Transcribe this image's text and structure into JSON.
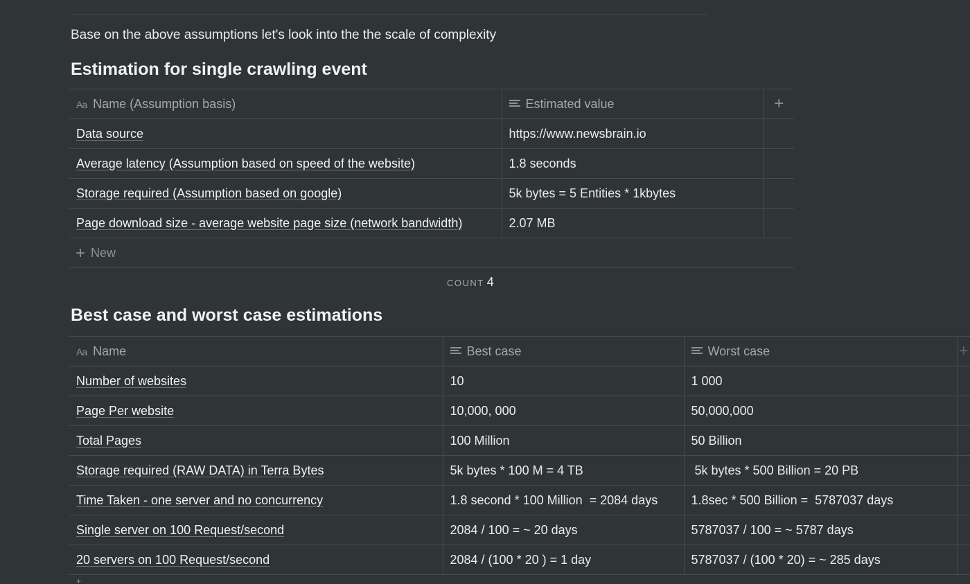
{
  "intro_text": "Base on the above assumptions let's look into the the scale of complexity",
  "section1": {
    "heading": "Estimation for single crawling event",
    "headers": [
      "Name (Assumption basis)",
      "Estimated value"
    ],
    "rows": [
      {
        "name": "Data source",
        "value": "https://www.newsbrain.io"
      },
      {
        "name": "Average latency (Assumption based on speed of the website)",
        "value": "1.8 seconds"
      },
      {
        "name": "Storage required (Assumption based on google)",
        "value": "5k bytes = 5 Entities * 1kbytes"
      },
      {
        "name": "Page download size - average website page size (network bandwidth)",
        "value": "2.07 MB"
      }
    ],
    "new_label": "New",
    "count_label": "COUNT",
    "count_value": "4"
  },
  "section2": {
    "heading": "Best case and worst case estimations",
    "headers": [
      "Name",
      "Best case",
      "Worst case"
    ],
    "rows": [
      {
        "name": "Number of websites",
        "best": "10",
        "worst": "1 000"
      },
      {
        "name": "Page Per website",
        "best": "10,000, 000",
        "worst": "50,000,000"
      },
      {
        "name": "Total Pages",
        "best": "100 Million",
        "worst": "50 Billion"
      },
      {
        "name": "Storage required (RAW DATA) in Terra Bytes",
        "best": "5k bytes * 100 M =  4 TB",
        "worst": " 5k bytes * 500 Billion = 20 PB"
      },
      {
        "name": "Time Taken - one server and no concurrency",
        "best": "1.8 second * 100 Million  = 2084 days",
        "worst": "1.8sec * 500 Billion =  5787037 days"
      },
      {
        "name": "Single server on 100 Request/second",
        "best": "2084 / 100 = ~ 20 days",
        "worst": "5787037 / 100 = ~ 5787 days"
      },
      {
        "name": "20 servers on 100 Request/second",
        "best": "2084 / (100 * 20 ) = 1 day",
        "worst": "5787037 / (100 * 20) = ~ 285 days"
      }
    ]
  },
  "icons": {
    "title_property": "aa-icon",
    "text_property": "text-lines-icon",
    "add_column": "plus-icon",
    "add_row": "plus-icon"
  },
  "colors": {
    "background": "#2f3437",
    "text": "#e6e6e5",
    "muted": "#a6a8a9",
    "border": "#454b4e"
  }
}
